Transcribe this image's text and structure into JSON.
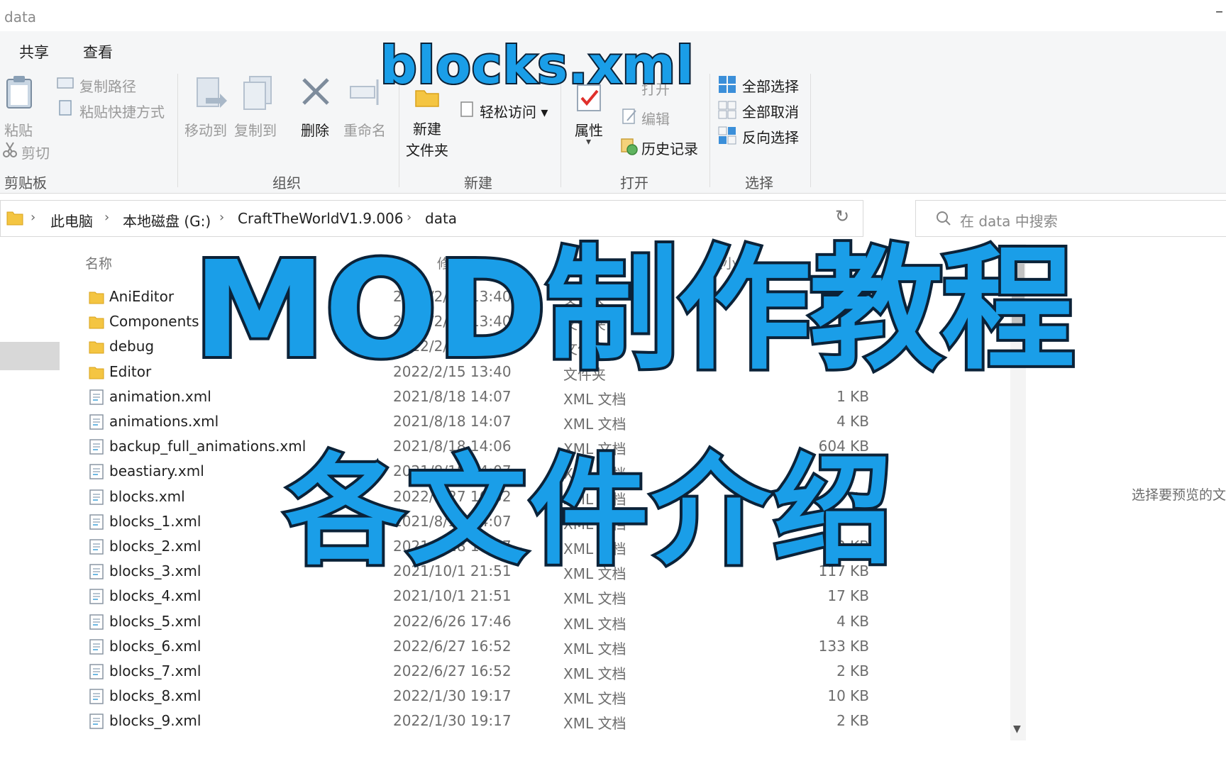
{
  "window": {
    "title": "data",
    "minimize_glyph": "–"
  },
  "tabs": [
    {
      "label": "共享"
    },
    {
      "label": "查看"
    }
  ],
  "ribbon": {
    "clipboard": {
      "group_label": "剪贴板",
      "paste": "粘贴",
      "copy_path": "复制路径",
      "paste_shortcut": "粘贴快捷方式",
      "cut": "剪切"
    },
    "organize": {
      "group_label": "组织",
      "move_to": "移动到",
      "copy_to": "复制到",
      "delete": "删除",
      "rename": "重命名"
    },
    "new": {
      "group_label": "新建",
      "new_folder_line1": "新建",
      "new_folder_line2": "文件夹",
      "easy_access": "轻松访问"
    },
    "open": {
      "group_label": "打开",
      "properties": "属性",
      "open": "打开",
      "edit": "编辑",
      "history": "历史记录"
    },
    "select": {
      "group_label": "选择",
      "select_all": "全部选择",
      "select_none": "全部取消",
      "invert": "反向选择"
    }
  },
  "address": {
    "crumbs": [
      "此电脑",
      "本地磁盘 (G:)",
      "CraftTheWorldV1.9.006",
      "data"
    ],
    "search_placeholder": "在 data 中搜索"
  },
  "columns": {
    "name": "名称",
    "date": "修改日期",
    "size": "大小"
  },
  "files": [
    {
      "name": "AniEditor",
      "date": "2022/2/15 13:40",
      "type": "文件夹",
      "size": "",
      "kind": "folder"
    },
    {
      "name": "Components",
      "date": "2022/2/15 13:40",
      "type": "文件夹",
      "size": "",
      "kind": "folder"
    },
    {
      "name": "debug",
      "date": "2022/2/15 13:40",
      "type": "文件夹",
      "size": "",
      "kind": "folder"
    },
    {
      "name": "Editor",
      "date": "2022/2/15 13:40",
      "type": "文件夹",
      "size": "",
      "kind": "folder"
    },
    {
      "name": "animation.xml",
      "date": "2021/8/18 14:07",
      "type": "XML 文档",
      "size": "1 KB",
      "kind": "file"
    },
    {
      "name": "animations.xml",
      "date": "2021/8/18 14:07",
      "type": "XML 文档",
      "size": "4 KB",
      "kind": "file"
    },
    {
      "name": "backup_full_animations.xml",
      "date": "2021/8/18 14:06",
      "type": "XML 文档",
      "size": "604 KB",
      "kind": "file"
    },
    {
      "name": "beastiary.xml",
      "date": "2021/8/18 14:07",
      "type": "XML 文档",
      "size": "",
      "kind": "file"
    },
    {
      "name": "blocks.xml",
      "date": "2022/6/27 16:52",
      "type": "XML 文档",
      "size": "",
      "kind": "file"
    },
    {
      "name": "blocks_1.xml",
      "date": "2021/8/18 14:07",
      "type": "XML 文档",
      "size": "",
      "kind": "file"
    },
    {
      "name": "blocks_2.xml",
      "date": "2021/8/18 14:07",
      "type": "XML 文档",
      "size": "22 KB",
      "kind": "file"
    },
    {
      "name": "blocks_3.xml",
      "date": "2021/10/1 21:51",
      "type": "XML 文档",
      "size": "117 KB",
      "kind": "file"
    },
    {
      "name": "blocks_4.xml",
      "date": "2021/10/1 21:51",
      "type": "XML 文档",
      "size": "17 KB",
      "kind": "file"
    },
    {
      "name": "blocks_5.xml",
      "date": "2022/6/26 17:46",
      "type": "XML 文档",
      "size": "4 KB",
      "kind": "file"
    },
    {
      "name": "blocks_6.xml",
      "date": "2022/6/27 16:52",
      "type": "XML 文档",
      "size": "133 KB",
      "kind": "file"
    },
    {
      "name": "blocks_7.xml",
      "date": "2022/6/27 16:52",
      "type": "XML 文档",
      "size": "2 KB",
      "kind": "file"
    },
    {
      "name": "blocks_8.xml",
      "date": "2022/1/30 19:17",
      "type": "XML 文档",
      "size": "10 KB",
      "kind": "file"
    },
    {
      "name": "blocks_9.xml",
      "date": "2022/1/30 19:17",
      "type": "XML 文档",
      "size": "2 KB",
      "kind": "file"
    }
  ],
  "preview_text": "选择要预览的文",
  "overlay": {
    "file": "blocks.xml",
    "title": "MOD制作教程",
    "subtitle": "各文件介绍"
  }
}
